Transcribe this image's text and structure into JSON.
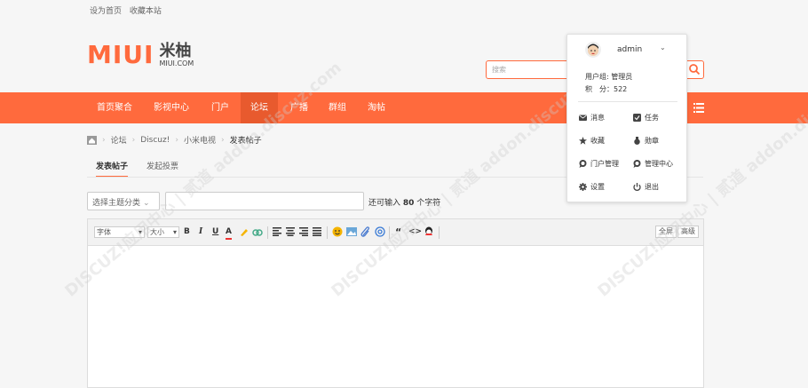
{
  "top_links": {
    "set_home": "设为首页",
    "favorite": "收藏本站"
  },
  "logo": {
    "mark": "MIUI",
    "cn": "米柚",
    "domain": "MIUI.COM"
  },
  "search": {
    "placeholder": "搜索"
  },
  "nav": {
    "items": [
      "首页聚合",
      "影视中心",
      "门户",
      "论坛",
      "广播",
      "群组",
      "淘帖"
    ],
    "active": "论坛"
  },
  "breadcrumb": [
    "论坛",
    "Discuz!",
    "小米电视",
    "发表帖子"
  ],
  "tabs": [
    "发表帖子",
    "发起投票"
  ],
  "form": {
    "type_select": "选择主题分类",
    "hint_prefix": "还可输入",
    "hint_count": "80",
    "hint_suffix": "个字符"
  },
  "toolbar": {
    "font": "字体",
    "size": "大小",
    "bold": "B",
    "italic": "I",
    "underline": "U",
    "color": "A",
    "quote": "“",
    "code": "<>",
    "fullscreen": "全屏",
    "advanced": "高级"
  },
  "user_menu": {
    "username": "admin",
    "group_label": "用户组: 管理员",
    "points_label": "积　分：522",
    "items": [
      "消息",
      "任务",
      "收藏",
      "勋章",
      "门户管理",
      "管理中心",
      "设置",
      "退出"
    ]
  },
  "watermark": "DISCUZ!应用中心 | 贰道 addon.discuz.com",
  "colors": {
    "accent": "#ff6a3d"
  }
}
